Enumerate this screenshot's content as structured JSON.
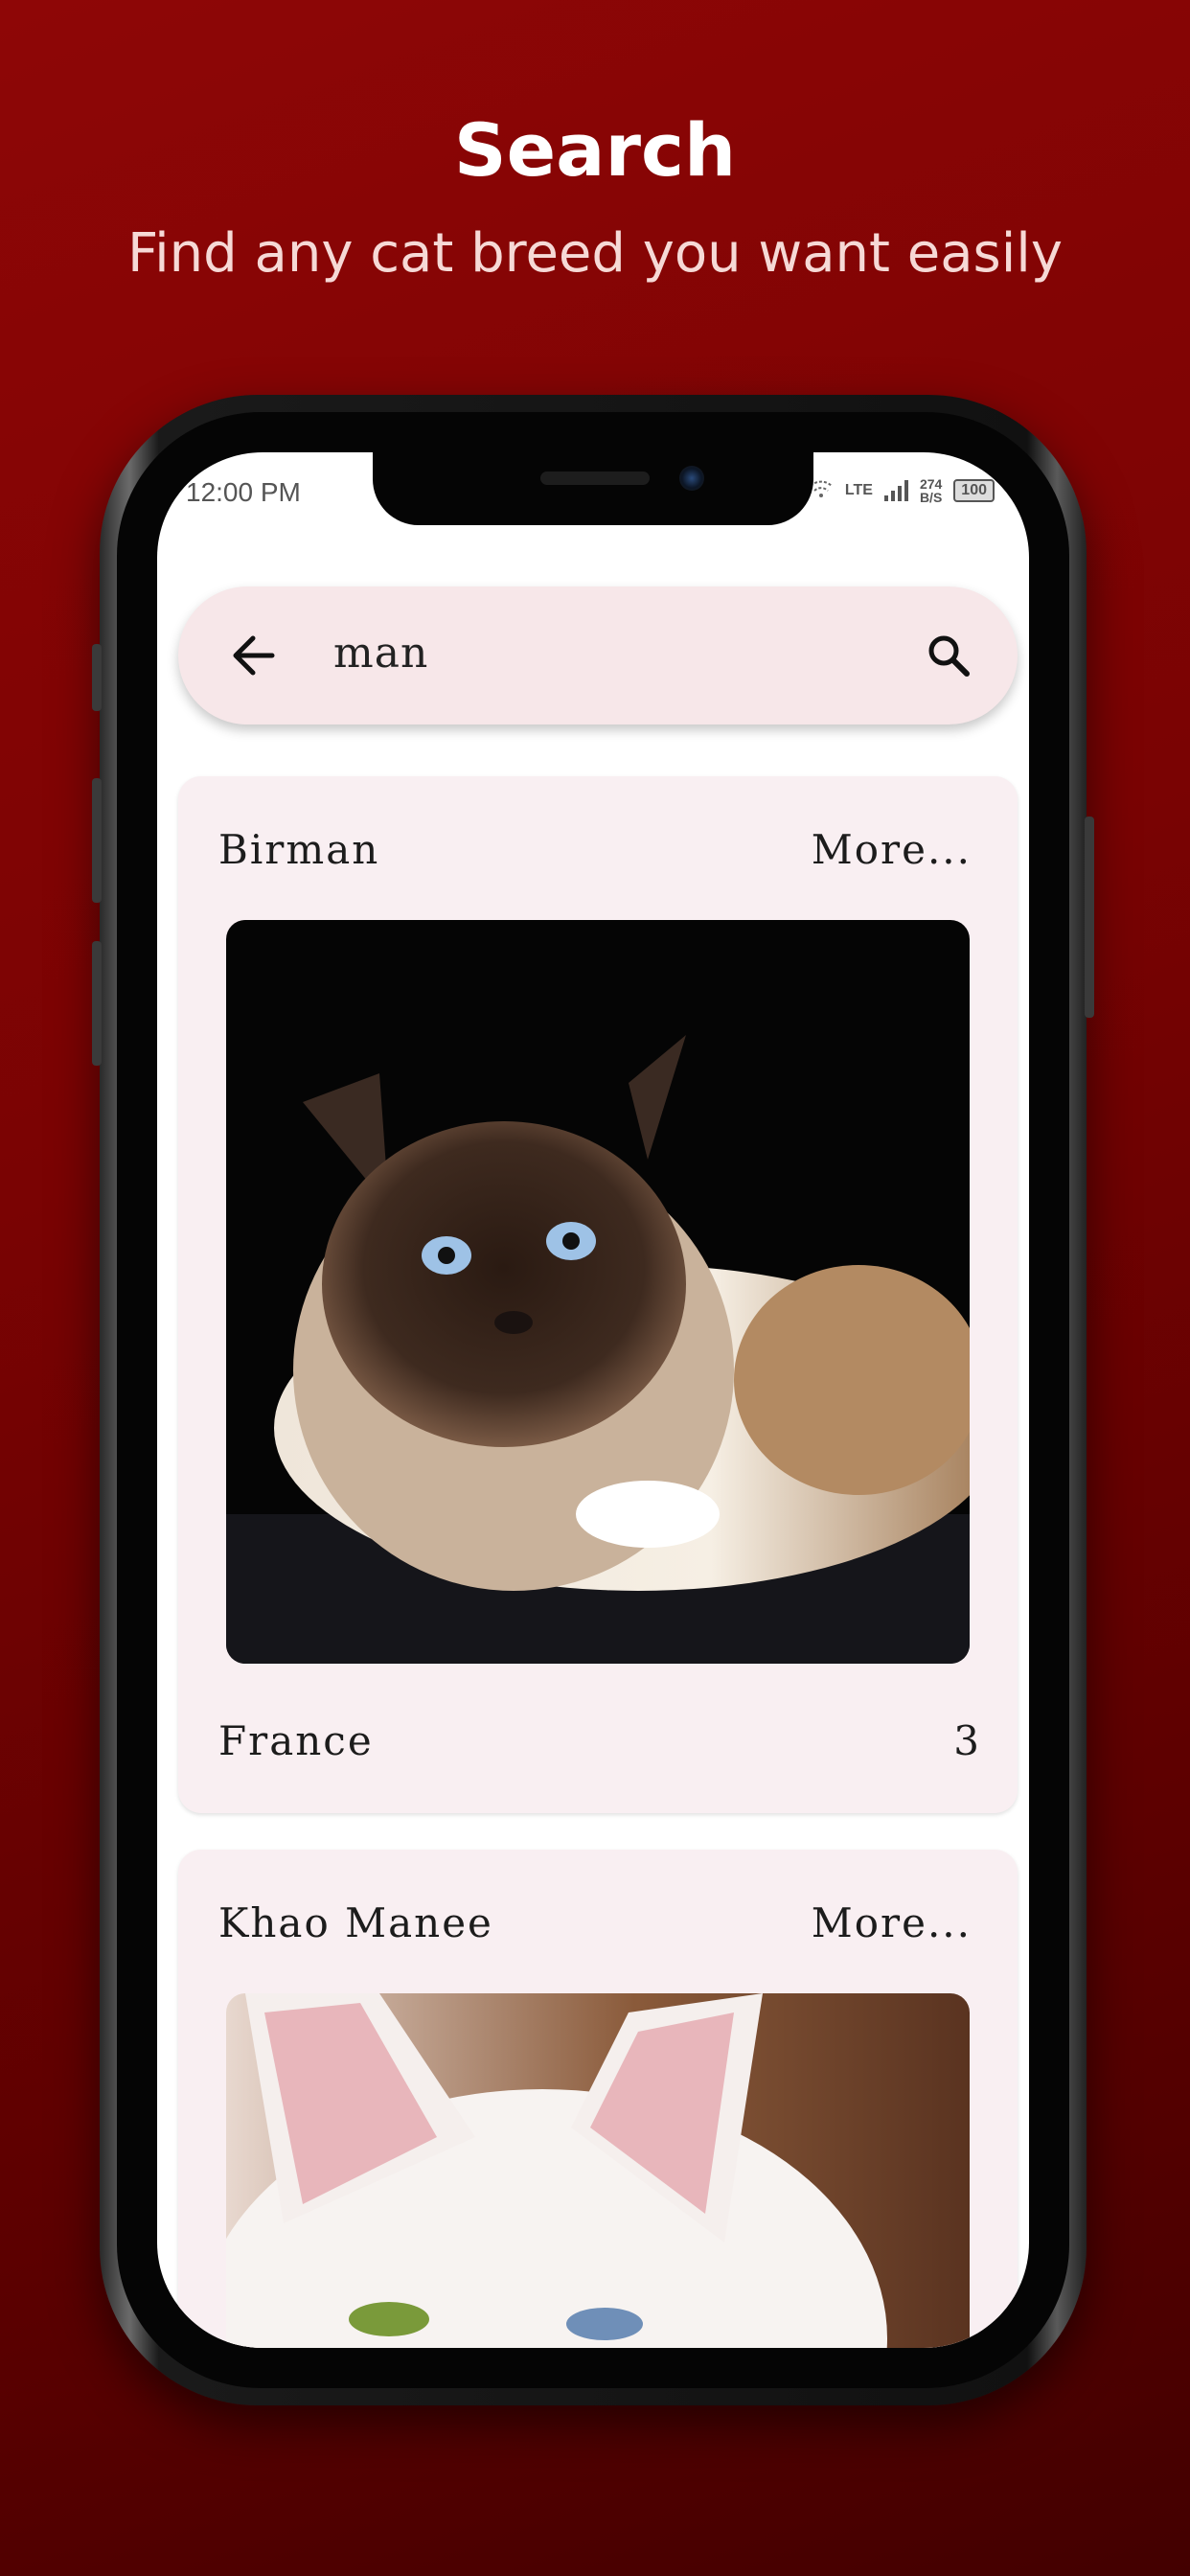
{
  "promo": {
    "title": "Search",
    "subtitle": "Find any cat breed you want easily"
  },
  "status_bar": {
    "time": "12:00 PM",
    "network": "LTE",
    "net_speed_value": "274",
    "net_speed_unit": "B/S",
    "battery": "100"
  },
  "search": {
    "query": "man",
    "back_icon": "arrow-left-icon",
    "search_icon": "magnifier-icon"
  },
  "results": [
    {
      "name": "Birman",
      "more_label": "More...",
      "image": "birman-cat-photo",
      "country": "France",
      "count": "3"
    },
    {
      "name": "Khao Manee",
      "more_label": "More...",
      "image": "khao-manee-cat-photo"
    }
  ],
  "colors": {
    "background": "#7a0303",
    "search_bar": "#f7e7e9",
    "card": "#f9eff2"
  }
}
